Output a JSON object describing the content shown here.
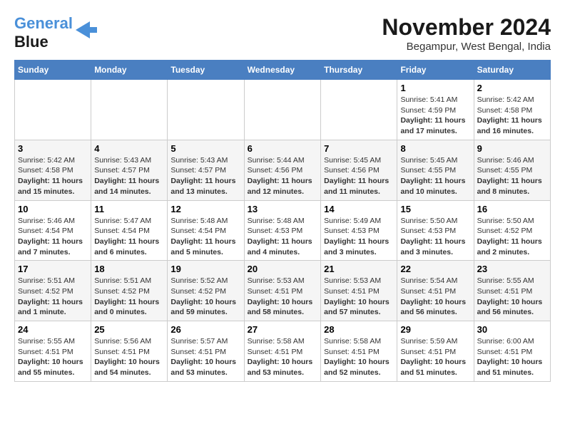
{
  "header": {
    "logo": {
      "line1": "General",
      "line2": "Blue"
    },
    "title": "November 2024",
    "location": "Begampur, West Bengal, India"
  },
  "weekdays": [
    "Sunday",
    "Monday",
    "Tuesday",
    "Wednesday",
    "Thursday",
    "Friday",
    "Saturday"
  ],
  "weeks": [
    {
      "days": [
        {
          "num": "",
          "info": ""
        },
        {
          "num": "",
          "info": ""
        },
        {
          "num": "",
          "info": ""
        },
        {
          "num": "",
          "info": ""
        },
        {
          "num": "",
          "info": ""
        },
        {
          "num": "1",
          "info": "Sunrise: 5:41 AM\nSunset: 4:59 PM\nDaylight: 11 hours and 17 minutes."
        },
        {
          "num": "2",
          "info": "Sunrise: 5:42 AM\nSunset: 4:58 PM\nDaylight: 11 hours and 16 minutes."
        }
      ]
    },
    {
      "days": [
        {
          "num": "3",
          "info": "Sunrise: 5:42 AM\nSunset: 4:58 PM\nDaylight: 11 hours and 15 minutes."
        },
        {
          "num": "4",
          "info": "Sunrise: 5:43 AM\nSunset: 4:57 PM\nDaylight: 11 hours and 14 minutes."
        },
        {
          "num": "5",
          "info": "Sunrise: 5:43 AM\nSunset: 4:57 PM\nDaylight: 11 hours and 13 minutes."
        },
        {
          "num": "6",
          "info": "Sunrise: 5:44 AM\nSunset: 4:56 PM\nDaylight: 11 hours and 12 minutes."
        },
        {
          "num": "7",
          "info": "Sunrise: 5:45 AM\nSunset: 4:56 PM\nDaylight: 11 hours and 11 minutes."
        },
        {
          "num": "8",
          "info": "Sunrise: 5:45 AM\nSunset: 4:55 PM\nDaylight: 11 hours and 10 minutes."
        },
        {
          "num": "9",
          "info": "Sunrise: 5:46 AM\nSunset: 4:55 PM\nDaylight: 11 hours and 8 minutes."
        }
      ]
    },
    {
      "days": [
        {
          "num": "10",
          "info": "Sunrise: 5:46 AM\nSunset: 4:54 PM\nDaylight: 11 hours and 7 minutes."
        },
        {
          "num": "11",
          "info": "Sunrise: 5:47 AM\nSunset: 4:54 PM\nDaylight: 11 hours and 6 minutes."
        },
        {
          "num": "12",
          "info": "Sunrise: 5:48 AM\nSunset: 4:54 PM\nDaylight: 11 hours and 5 minutes."
        },
        {
          "num": "13",
          "info": "Sunrise: 5:48 AM\nSunset: 4:53 PM\nDaylight: 11 hours and 4 minutes."
        },
        {
          "num": "14",
          "info": "Sunrise: 5:49 AM\nSunset: 4:53 PM\nDaylight: 11 hours and 3 minutes."
        },
        {
          "num": "15",
          "info": "Sunrise: 5:50 AM\nSunset: 4:53 PM\nDaylight: 11 hours and 3 minutes."
        },
        {
          "num": "16",
          "info": "Sunrise: 5:50 AM\nSunset: 4:52 PM\nDaylight: 11 hours and 2 minutes."
        }
      ]
    },
    {
      "days": [
        {
          "num": "17",
          "info": "Sunrise: 5:51 AM\nSunset: 4:52 PM\nDaylight: 11 hours and 1 minute."
        },
        {
          "num": "18",
          "info": "Sunrise: 5:51 AM\nSunset: 4:52 PM\nDaylight: 11 hours and 0 minutes."
        },
        {
          "num": "19",
          "info": "Sunrise: 5:52 AM\nSunset: 4:52 PM\nDaylight: 10 hours and 59 minutes."
        },
        {
          "num": "20",
          "info": "Sunrise: 5:53 AM\nSunset: 4:51 PM\nDaylight: 10 hours and 58 minutes."
        },
        {
          "num": "21",
          "info": "Sunrise: 5:53 AM\nSunset: 4:51 PM\nDaylight: 10 hours and 57 minutes."
        },
        {
          "num": "22",
          "info": "Sunrise: 5:54 AM\nSunset: 4:51 PM\nDaylight: 10 hours and 56 minutes."
        },
        {
          "num": "23",
          "info": "Sunrise: 5:55 AM\nSunset: 4:51 PM\nDaylight: 10 hours and 56 minutes."
        }
      ]
    },
    {
      "days": [
        {
          "num": "24",
          "info": "Sunrise: 5:55 AM\nSunset: 4:51 PM\nDaylight: 10 hours and 55 minutes."
        },
        {
          "num": "25",
          "info": "Sunrise: 5:56 AM\nSunset: 4:51 PM\nDaylight: 10 hours and 54 minutes."
        },
        {
          "num": "26",
          "info": "Sunrise: 5:57 AM\nSunset: 4:51 PM\nDaylight: 10 hours and 53 minutes."
        },
        {
          "num": "27",
          "info": "Sunrise: 5:58 AM\nSunset: 4:51 PM\nDaylight: 10 hours and 53 minutes."
        },
        {
          "num": "28",
          "info": "Sunrise: 5:58 AM\nSunset: 4:51 PM\nDaylight: 10 hours and 52 minutes."
        },
        {
          "num": "29",
          "info": "Sunrise: 5:59 AM\nSunset: 4:51 PM\nDaylight: 10 hours and 51 minutes."
        },
        {
          "num": "30",
          "info": "Sunrise: 6:00 AM\nSunset: 4:51 PM\nDaylight: 10 hours and 51 minutes."
        }
      ]
    }
  ]
}
